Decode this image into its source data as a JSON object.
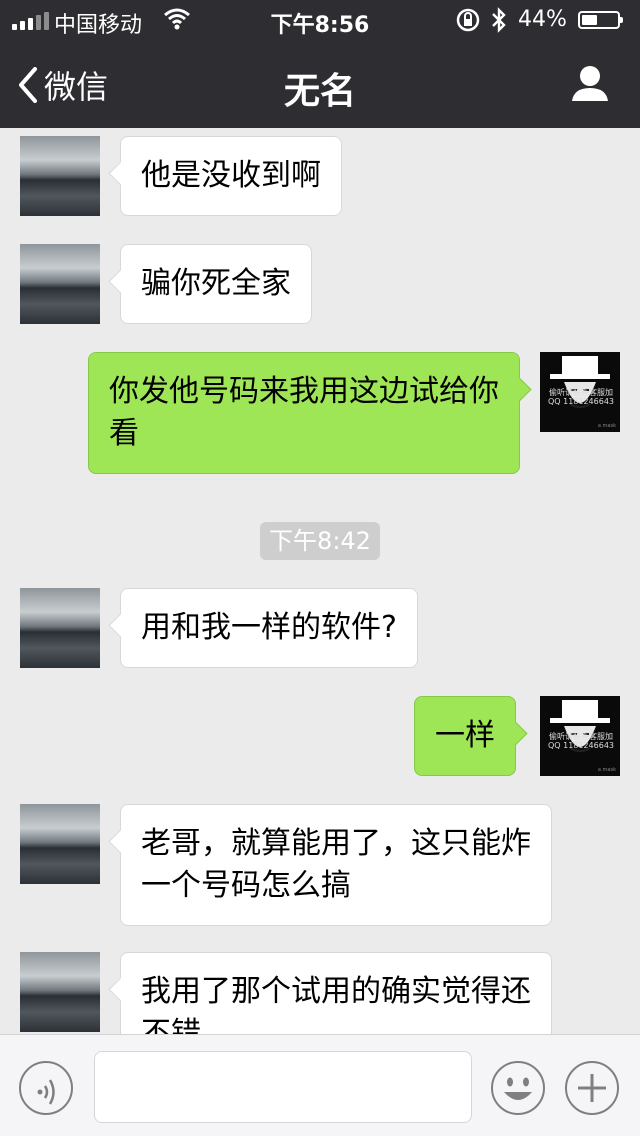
{
  "status_bar": {
    "carrier": "中国移动",
    "time": "下午8:56",
    "battery_percent": "44%",
    "battery_level": 0.44,
    "icons": [
      "signal-icon",
      "wifi-icon",
      "orientation-lock-icon",
      "bluetooth-icon",
      "battery-icon"
    ]
  },
  "nav": {
    "back_label": "微信",
    "title": "无名",
    "profile_icon": "person-icon"
  },
  "avatars": {
    "contact_avatar": "scenery-photo",
    "self_avatar": {
      "text": "偷听请联系客服加QQ 1181246643",
      "tiny": "a mask"
    }
  },
  "messages": [
    {
      "side": "left",
      "text": "他是没收到啊"
    },
    {
      "side": "left",
      "text": "骗你死全家"
    },
    {
      "side": "right",
      "text": "你发他号码来我用这边试给你看"
    },
    {
      "type": "time",
      "text": "下午8:42"
    },
    {
      "side": "left",
      "text": "用和我一样的软件?"
    },
    {
      "side": "right",
      "text": "一样"
    },
    {
      "side": "left",
      "text": "老哥，就算能用了，这只能炸一个号码怎么搞"
    },
    {
      "side": "left",
      "text": "我用了那个试用的确实觉得还不错"
    }
  ],
  "input_bar": {
    "voice_icon": "voice-icon",
    "emoji_icon": "emoji-icon",
    "plus_icon": "plus-icon",
    "text_value": ""
  },
  "colors": {
    "nav_bg": "#2e2e32",
    "chat_bg": "#ebebeb",
    "self_bubble": "#9fe657",
    "other_bubble": "#ffffff",
    "time_badge": "#cecece"
  }
}
